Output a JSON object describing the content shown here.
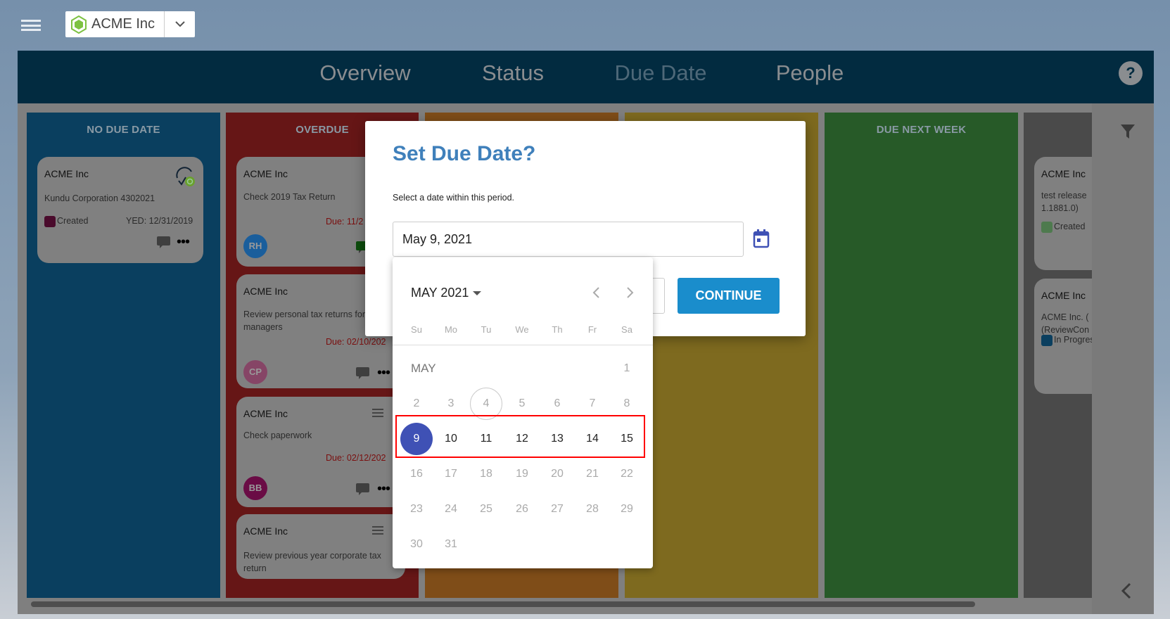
{
  "topbar": {
    "org_name": "ACME Inc",
    "icons": {
      "menu": "hamburger-icon",
      "org": "hexagon-logo-icon",
      "dropdown": "chevron-down-icon"
    }
  },
  "header": {
    "tabs": [
      {
        "label": "Overview"
      },
      {
        "label": "Status"
      },
      {
        "label": "Due Date",
        "active": true
      },
      {
        "label": "People"
      }
    ],
    "help": "?"
  },
  "columns": [
    {
      "title": "NO DUE DATE",
      "color": "#0a3f5f",
      "cards": [
        {
          "org": "ACME Inc",
          "desc": "Kundu Corporation 4302021",
          "status": "Created",
          "status_color": "#4a0b2c",
          "yed": "YED: 12/31/2019"
        }
      ]
    },
    {
      "title": "OVERDUE",
      "color": "#661616",
      "cards": [
        {
          "org": "ACME Inc",
          "desc": "Check 2019 Tax Return",
          "due": "Due: 11/2",
          "avatar": "RH",
          "avatar_color": "#1a5e9c"
        },
        {
          "org": "ACME Inc",
          "desc": "Review personal tax returns for managers",
          "due": "Due: 02/10/202",
          "avatar": "CP",
          "avatar_color": "#864566"
        },
        {
          "org": "ACME Inc",
          "desc": "Check paperwork",
          "due": "Due: 02/12/202",
          "avatar": "BB",
          "avatar_color": "#6a0c45"
        },
        {
          "org": "ACME Inc",
          "desc": "Review previous year corporate tax return"
        }
      ]
    },
    {
      "title": "",
      "color": "#7f4d18",
      "cards": []
    },
    {
      "title": "",
      "color": "#7e6a1f",
      "cards": []
    },
    {
      "title": "DUE NEXT WEEK",
      "color": "#275a28",
      "cards": []
    },
    {
      "title": "",
      "color": "#4a4a4a",
      "cards": [
        {
          "org": "ACME Inc",
          "desc": "test release 1.1881.0)",
          "status": "Created",
          "status_color": "#4e7a4e"
        },
        {
          "org": "ACME Inc",
          "desc": "ACME Inc. ( (ReviewCon",
          "status": "In Progres",
          "status_color": "#0b3f5f"
        }
      ]
    }
  ],
  "dialog": {
    "title": "Set Due Date?",
    "subtitle": "Select a date within this period.",
    "date_value": "May 9, 2021",
    "continue_label": "CONTINUE",
    "accent": "#3f51b5"
  },
  "calendar": {
    "month_year": "MAY 2021",
    "month_label": "MAY",
    "weekdays": [
      "Su",
      "Mo",
      "Tu",
      "We",
      "Th",
      "Fr",
      "Sa"
    ],
    "weeks": [
      [
        null,
        null,
        null,
        null,
        null,
        null,
        1
      ],
      [
        2,
        3,
        4,
        5,
        6,
        7,
        8
      ],
      [
        9,
        10,
        11,
        12,
        13,
        14,
        15
      ],
      [
        16,
        17,
        18,
        19,
        20,
        21,
        22
      ],
      [
        23,
        24,
        25,
        26,
        27,
        28,
        29
      ],
      [
        30,
        31,
        null,
        null,
        null,
        null,
        null
      ]
    ],
    "today": 4,
    "selected": 9,
    "enabled_range": [
      9,
      15
    ]
  }
}
